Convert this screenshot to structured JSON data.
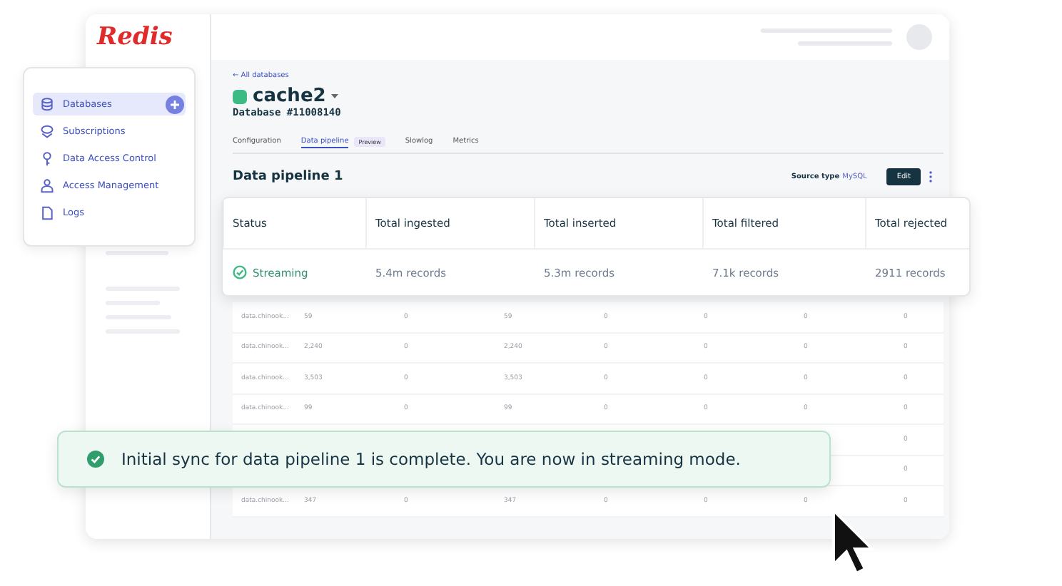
{
  "logo": "Redis",
  "nav": [
    {
      "label": "Databases",
      "selected": true
    },
    {
      "label": "Subscriptions",
      "selected": false
    },
    {
      "label": "Data Access Control",
      "selected": false
    },
    {
      "label": "Access Management",
      "selected": false
    },
    {
      "label": "Logs",
      "selected": false
    }
  ],
  "back_link": "← All databases",
  "database": {
    "name": "cache2",
    "id": "Database #11008140"
  },
  "tabs": [
    {
      "label": "Configuration",
      "selected": false
    },
    {
      "label": "Data pipeline",
      "selected": true,
      "badge": "Preview"
    },
    {
      "label": "Slowlog",
      "selected": false
    },
    {
      "label": "Metrics",
      "selected": false
    }
  ],
  "pipeline": {
    "title": "Data pipeline 1",
    "source_label": "Source type",
    "source_value": "MySQL",
    "edit": "Edit"
  },
  "metrics": {
    "columns": [
      "Status",
      "Total ingested",
      "Total inserted",
      "Total filtered",
      "Total rejected"
    ],
    "values": [
      "Streaming",
      "5.4m records",
      "5.3m records",
      "7.1k records",
      "2911 records"
    ]
  },
  "table_rows": [
    [
      "data.chinook...",
      "59",
      "0",
      "59",
      "0",
      "0",
      "0",
      "0"
    ],
    [
      "data.chinook...",
      "2,240",
      "0",
      "2,240",
      "0",
      "0",
      "0",
      "0"
    ],
    [
      "data.chinook...",
      "3,503",
      "0",
      "3,503",
      "0",
      "0",
      "0",
      "0"
    ],
    [
      "data.chinook...",
      "99",
      "0",
      "99",
      "0",
      "0",
      "0",
      "0"
    ],
    [
      "0"
    ],
    [
      "0"
    ],
    [
      "data.chinook...",
      "347",
      "0",
      "347",
      "0",
      "0",
      "0",
      "0"
    ]
  ],
  "toast": "Initial sync for data pipeline 1 is complete. You are now in streaming mode."
}
